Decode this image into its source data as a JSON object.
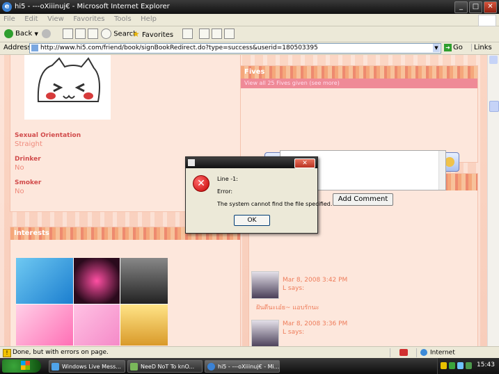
{
  "window": {
    "title": "hi5 - ---oXiiinuj€ - Microsoft Internet Explorer",
    "controls": {
      "minimize": "_",
      "maximize": "□",
      "close": "✕"
    }
  },
  "menu": [
    "File",
    "Edit",
    "View",
    "Favorites",
    "Tools",
    "Help"
  ],
  "toolbar": {
    "back": "Back",
    "search": "Search",
    "favorites": "Favorites"
  },
  "address": {
    "label": "Address",
    "url": "http://www.hi5.com/friend/book/signBookRedirect.do?type=success&userid=180503395",
    "go": "Go",
    "links": "Links"
  },
  "profile": {
    "fields": [
      {
        "label": "Sexual Orientation",
        "value": "Straight"
      },
      {
        "label": "Drinker",
        "value": "No"
      },
      {
        "label": "Smoker",
        "value": "No"
      }
    ]
  },
  "fives": {
    "title": "Fives",
    "subtitle": "View all 25 Fives given (see more)"
  },
  "interests": {
    "title": "Interests"
  },
  "comment": {
    "add_button": "Add Comment"
  },
  "comments": [
    {
      "date": "Mar 8, 2008 3:42 PM",
      "says": "L says:",
      "text": "ฝันดีนะเอ๋ย~ แอบรักนะ"
    },
    {
      "date": "Mar 8, 2008 3:36 PM",
      "says": "L says:"
    }
  ],
  "dialog": {
    "close": "✕",
    "lines": [
      "Line -1:",
      "Error:",
      "The system cannot find the file specified."
    ],
    "ok": "OK"
  },
  "status": {
    "text": "Done, but with errors on page.",
    "zone": "Internet"
  },
  "taskbar": {
    "tasks": [
      "Windows Live Mess...",
      "NeeD NoT To knO...",
      "hi5 - ---oXiiinuj€ - Mi..."
    ],
    "clock": "15:43"
  }
}
